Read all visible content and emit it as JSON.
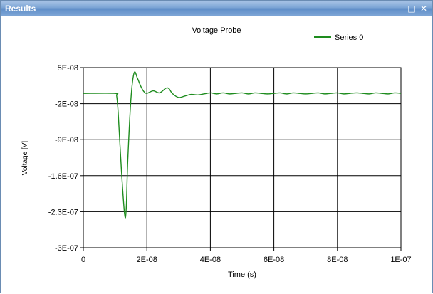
{
  "window": {
    "title": "Results",
    "maximize_icon": "maximize-icon",
    "close_icon": "close-icon"
  },
  "colors": {
    "series": "#1e8c1e",
    "grid": "#000000",
    "titlebar": "#7ea6d6"
  },
  "chart_data": {
    "type": "line",
    "title": "Voltage Probe",
    "xlabel": "Time (s)",
    "ylabel": "Voltage [V]",
    "xlim": [
      0,
      1e-07
    ],
    "ylim": [
      -3e-07,
      5e-08
    ],
    "x_ticks": [
      0,
      2e-08,
      4e-08,
      6e-08,
      8e-08,
      1e-07
    ],
    "x_tick_labels": [
      "0",
      "2E-08",
      "4E-08",
      "6E-08",
      "8E-08",
      "1E-07"
    ],
    "y_ticks": [
      5e-08,
      -2e-08,
      -9e-08,
      -1.6e-07,
      -2.3e-07,
      -3e-07
    ],
    "y_tick_labels": [
      "5E-08",
      "-2E-08",
      "-9E-08",
      "-1.6E-07",
      "-2.3E-07",
      "-3E-07"
    ],
    "grid": true,
    "legend_position": "top-right",
    "series": [
      {
        "name": "Series 0",
        "x": [
          0,
          1e-08,
          1.05e-08,
          1.1e-08,
          1.2e-08,
          1.3e-08,
          1.35e-08,
          1.4e-08,
          1.5e-08,
          1.6e-08,
          1.7e-08,
          1.8e-08,
          1.9e-08,
          2e-08,
          2.2e-08,
          2.4e-08,
          2.6e-08,
          2.7e-08,
          2.8e-08,
          3e-08,
          3.2e-08,
          3.4e-08,
          3.6e-08,
          3.8e-08,
          4e-08,
          4.2e-08,
          4.4e-08,
          4.6e-08,
          4.8e-08,
          5e-08,
          5.2e-08,
          5.4e-08,
          5.6e-08,
          5.8e-08,
          6e-08,
          6.2e-08,
          6.4e-08,
          6.6e-08,
          6.8e-08,
          7e-08,
          7.2e-08,
          7.4e-08,
          7.6e-08,
          7.8e-08,
          8e-08,
          8.2e-08,
          8.4e-08,
          8.6e-08,
          8.8e-08,
          9e-08,
          9.2e-08,
          9.4e-08,
          9.6e-08,
          9.8e-08,
          1e-07
        ],
        "values": [
          0,
          0,
          -5e-09,
          -4e-08,
          -1.5e-07,
          -2.35e-07,
          -2.25e-07,
          -1.3e-07,
          -1e-08,
          4e-08,
          3e-08,
          1.5e-08,
          4e-09,
          0,
          5e-09,
          1e-09,
          1e-08,
          9e-09,
          0,
          -8e-09,
          -5e-09,
          -2e-09,
          -3e-09,
          -1e-09,
          1e-09,
          -1e-09,
          1e-09,
          -1e-09,
          0,
          1e-09,
          -1e-09,
          1e-09,
          0,
          -1e-09,
          0,
          1e-09,
          -1e-09,
          1e-09,
          0,
          -1e-09,
          0,
          1e-09,
          -1e-09,
          0,
          1e-09,
          -1e-09,
          0,
          1e-09,
          0,
          -1e-09,
          1e-09,
          0,
          -1e-09,
          1e-09,
          0
        ]
      }
    ]
  }
}
